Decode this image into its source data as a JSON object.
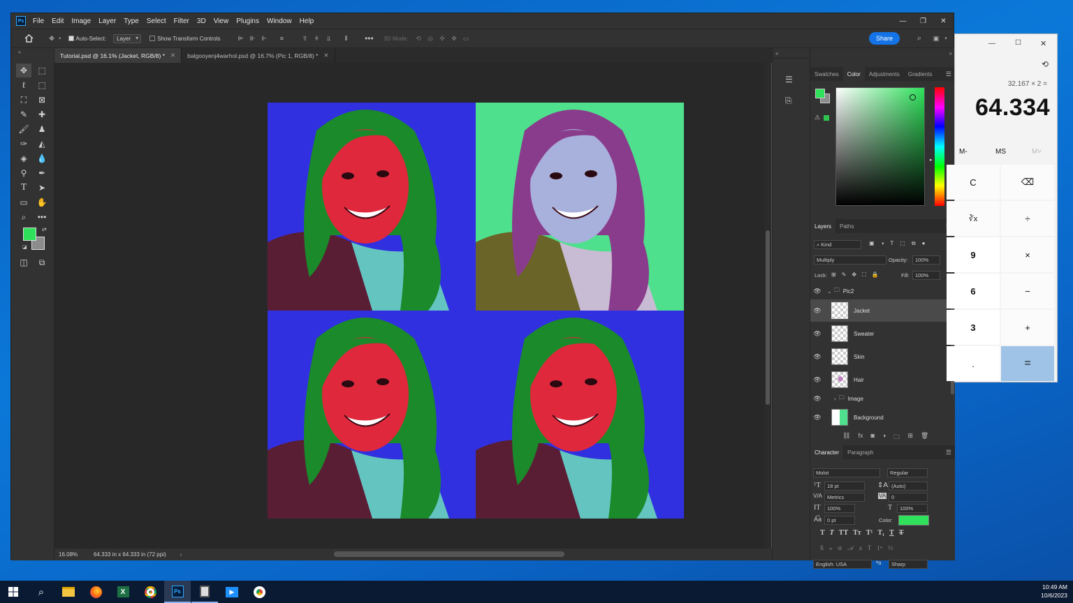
{
  "photoshop": {
    "menu": [
      "File",
      "Edit",
      "Image",
      "Layer",
      "Type",
      "Select",
      "Filter",
      "3D",
      "View",
      "Plugins",
      "Window",
      "Help"
    ],
    "options": {
      "auto_select_label": "Auto-Select:",
      "auto_select_target": "Layer",
      "show_transform_label": "Show Transform Controls",
      "mode_3d": "3D Mode:",
      "share_label": "Share"
    },
    "tabs": [
      {
        "label": "Tutorial.psd @ 16.1% (Jacket, RGB/8) *",
        "active": true
      },
      {
        "label": "balgooyenj4warhol.psd @ 16.7% (Pic 1, RGB/8) *",
        "active": false
      }
    ],
    "status": {
      "zoom": "16.08%",
      "doc_info": "64.333 in x 64.333 in (72 ppi)"
    },
    "foreground_color": "#2ee05a",
    "background_color": "#8c8c8c",
    "color_panel": {
      "tabs": [
        "Swatches",
        "Color",
        "Adjustments",
        "Gradients"
      ],
      "active_tab": "Color"
    },
    "layers_panel": {
      "tabs": [
        "Layers",
        "Paths"
      ],
      "filter_kind": "Kind",
      "blend_mode": "Multiply",
      "opacity_label": "Opacity:",
      "opacity": "100%",
      "lock_label": "Lock:",
      "fill_label": "Fill:",
      "fill": "100%",
      "layers": [
        {
          "name": "Pic2",
          "type": "group-open"
        },
        {
          "name": "Jacket",
          "type": "layer",
          "selected": true
        },
        {
          "name": "Sweater",
          "type": "layer"
        },
        {
          "name": "Skin",
          "type": "layer"
        },
        {
          "name": "Hair",
          "type": "layer"
        },
        {
          "name": "Image",
          "type": "group-closed"
        },
        {
          "name": "Background",
          "type": "layer"
        }
      ]
    },
    "character_panel": {
      "tabs": [
        "Character",
        "Paragraph"
      ],
      "font_family": "Molot",
      "font_style": "Regular",
      "size": "18 pt",
      "leading": "(Auto)",
      "kerning": "Metrics",
      "tracking": "0",
      "vertical_scale": "100%",
      "horizontal_scale": "100%",
      "baseline": "0 pt",
      "color_label": "Color:",
      "text_color": "#2ee05a",
      "language": "English: USA",
      "antialias_symbol": "ªa",
      "antialias": "Sharp"
    }
  },
  "canvas": {
    "quadrants": [
      {
        "bg": "#3030e0",
        "skin": "#e0283c",
        "hair": "#1a8a2a"
      },
      {
        "bg": "#4ee08c",
        "skin": "#a8b0dc",
        "hair": "#8a3c8c"
      },
      {
        "bg": "#3030e0",
        "skin": "#e0283c",
        "hair": "#1a8a2a"
      },
      {
        "bg": "#3030e0",
        "skin": "#e0283c",
        "hair": "#1a8a2a"
      }
    ]
  },
  "calculator": {
    "expression": "32.167 × 2 =",
    "display": "64.334",
    "memory": [
      "M-",
      "MS",
      "M˅"
    ],
    "buttons": [
      "C",
      "⌫",
      "∛x",
      "÷",
      "9",
      "×",
      "6",
      "−",
      "3",
      "+",
      ".",
      "="
    ]
  },
  "taskbar": {
    "time": "10:49 AM",
    "date": "10/6/2023"
  }
}
